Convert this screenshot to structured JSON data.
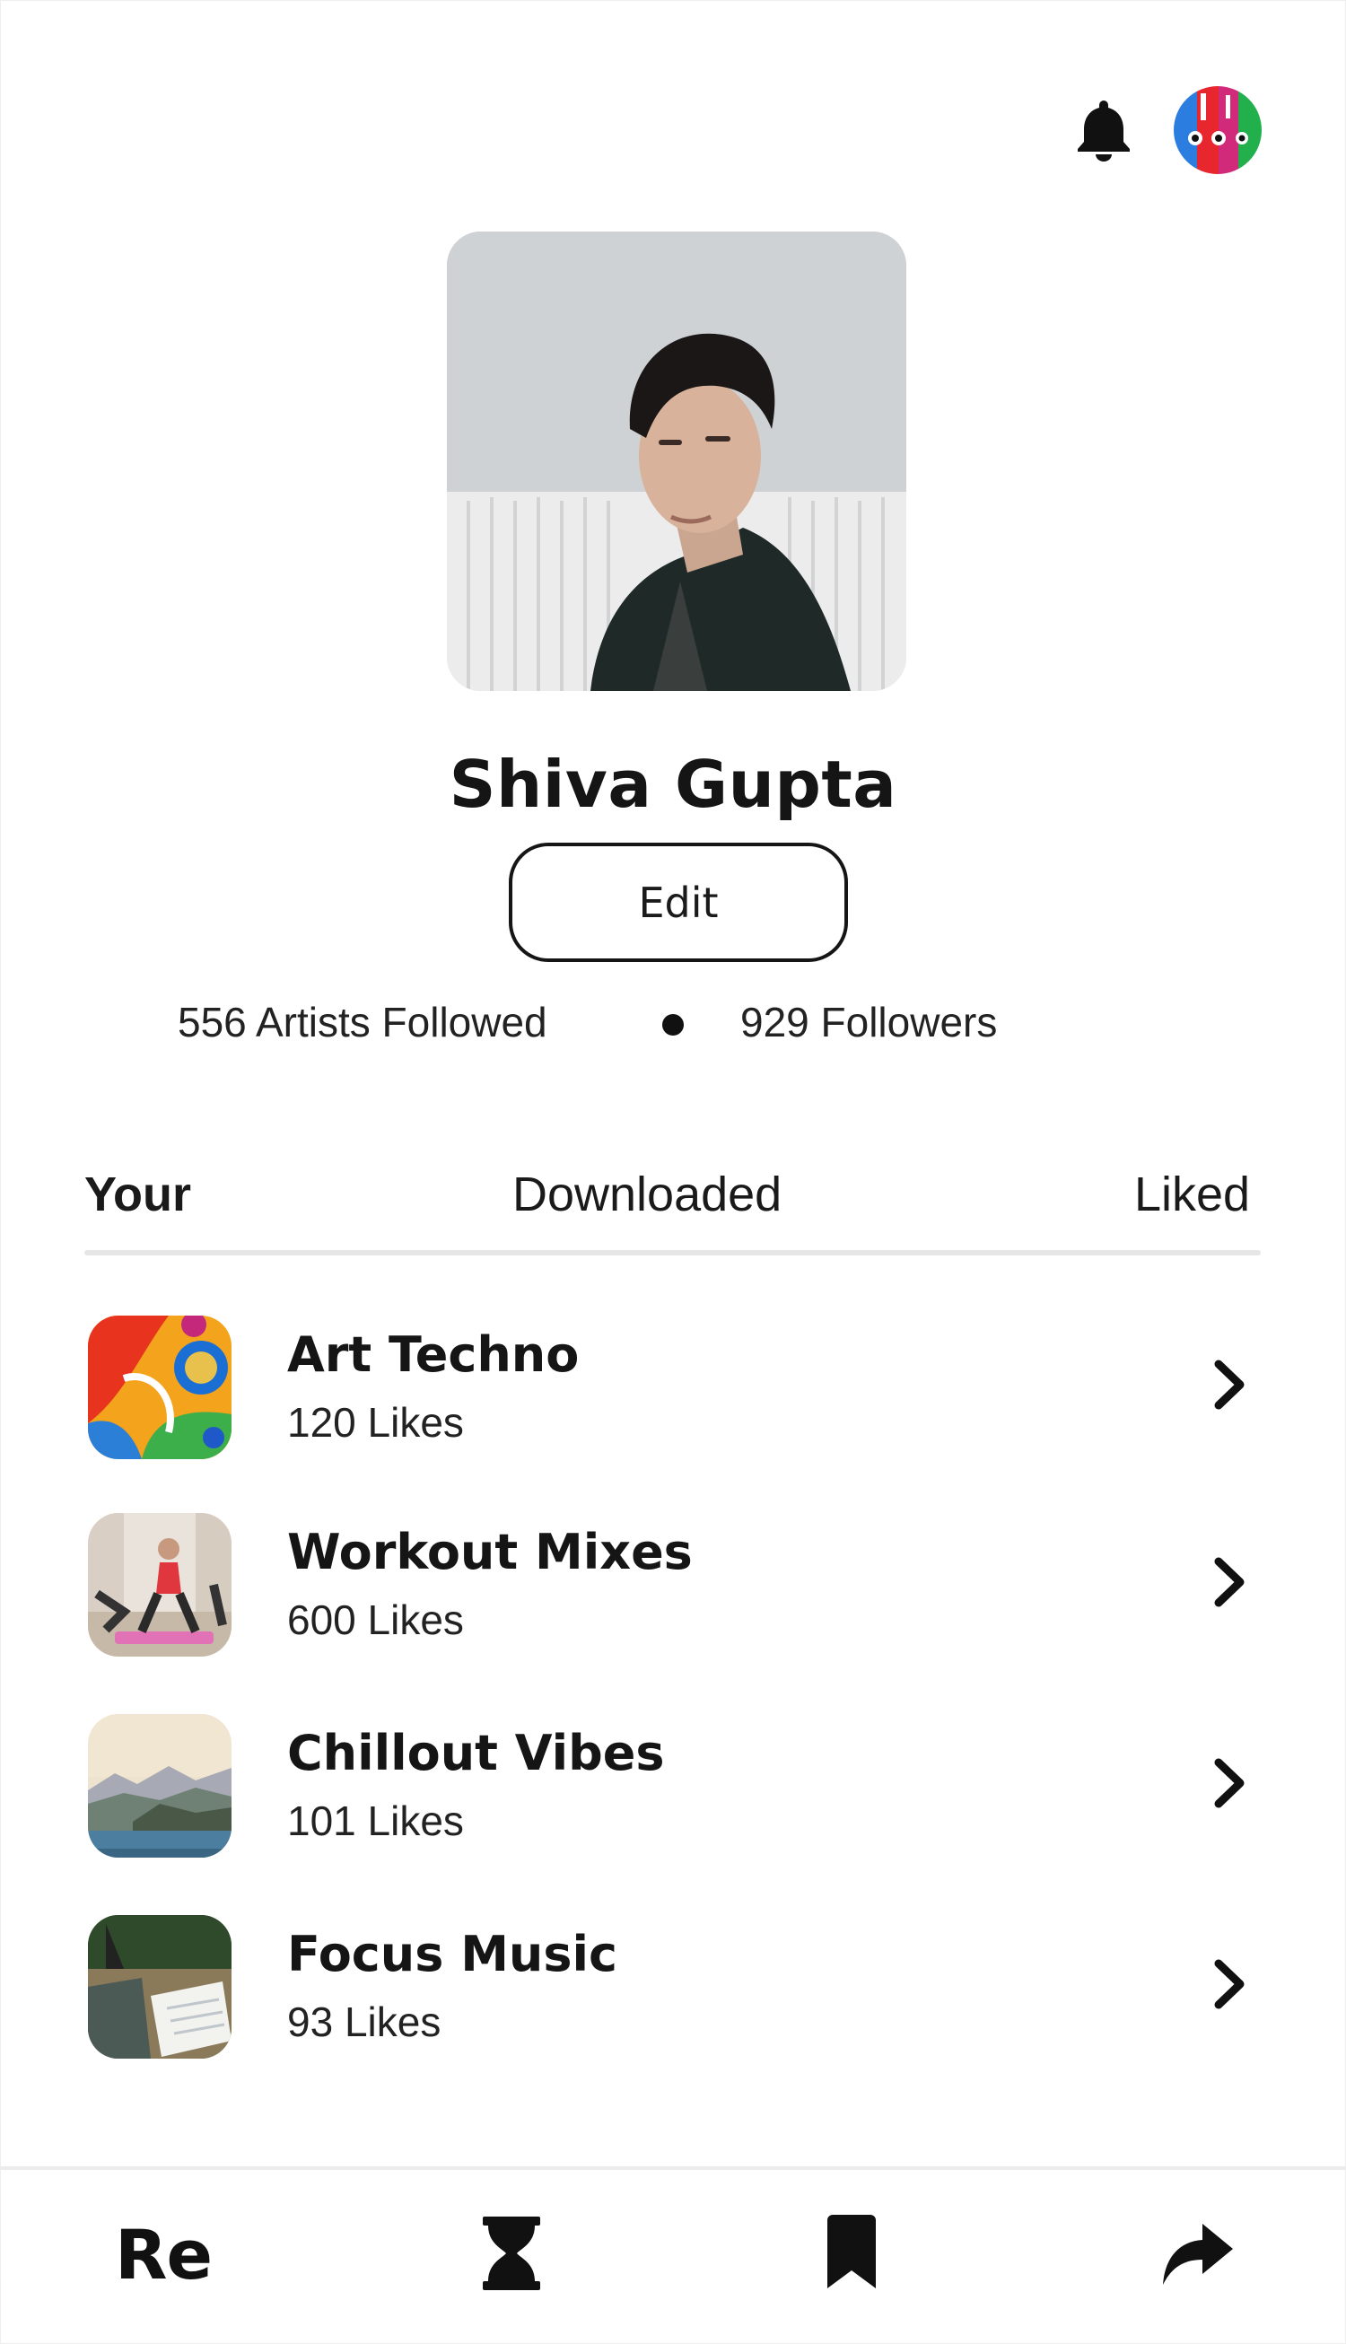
{
  "header": {
    "notifications_icon": "bell-icon",
    "avatar_icon": "user-avatar"
  },
  "profile": {
    "name": "Shiva Gupta",
    "edit_label": "Edit",
    "artists_followed": "556 Artists Followed",
    "followers": "929 Followers"
  },
  "tabs": [
    {
      "label": "Your",
      "active": true
    },
    {
      "label": "Downloaded",
      "active": false
    },
    {
      "label": "Liked",
      "active": false
    }
  ],
  "playlists": [
    {
      "title": "Art Techno",
      "likes": "120 Likes",
      "thumb": "abstract-paint"
    },
    {
      "title": "Workout Mixes",
      "likes": "600 Likes",
      "thumb": "workout-photo"
    },
    {
      "title": "Chillout Vibes",
      "likes": "101 Likes",
      "thumb": "coastal-landscape"
    },
    {
      "title": "Focus Music",
      "likes": "93 Likes",
      "thumb": "desk-notebook"
    }
  ],
  "bottom_nav": {
    "logo": "Re",
    "items": [
      "hourglass-icon",
      "bookmark-icon",
      "share-icon"
    ]
  },
  "colors": {
    "text": "#151515",
    "divider": "#e6e6e6",
    "background": "#ffffff"
  }
}
